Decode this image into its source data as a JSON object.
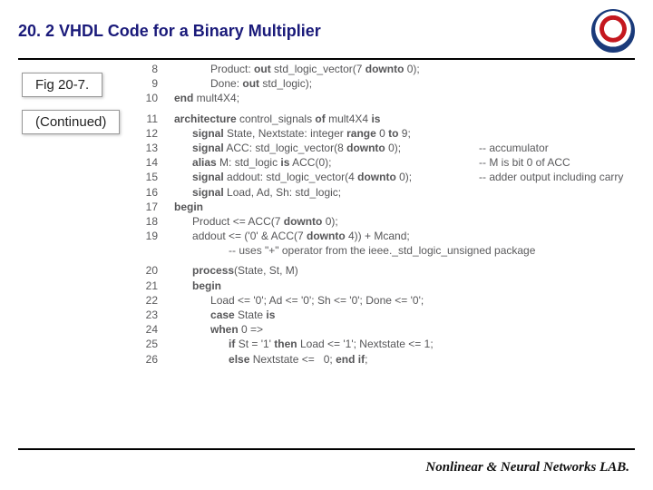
{
  "header": {
    "title": "20. 2 VHDL Code for a Binary Multiplier",
    "logo_name": "university-seal"
  },
  "caption": {
    "fig": "Fig 20-7.",
    "cont": "(Continued)"
  },
  "code": [
    {
      "n": "8",
      "indent": 2,
      "segs": [
        {
          "t": "Product: "
        },
        {
          "t": "out",
          "k": true
        },
        {
          "t": " std_logic_vector(7 "
        },
        {
          "t": "downto",
          "k": true
        },
        {
          "t": " 0);"
        }
      ]
    },
    {
      "n": "9",
      "indent": 2,
      "segs": [
        {
          "t": "Done: "
        },
        {
          "t": "out",
          "k": true
        },
        {
          "t": " std_logic);"
        }
      ]
    },
    {
      "n": "10",
      "indent": 0,
      "segs": [
        {
          "t": "end",
          "k": true
        },
        {
          "t": " mult4X4;"
        }
      ]
    },
    {
      "gap": true
    },
    {
      "n": "11",
      "indent": 0,
      "segs": [
        {
          "t": "architecture",
          "k": true
        },
        {
          "t": " control_signals "
        },
        {
          "t": "of",
          "k": true
        },
        {
          "t": " mult4X4 "
        },
        {
          "t": "is",
          "k": true
        }
      ]
    },
    {
      "n": "12",
      "indent": 1,
      "segs": [
        {
          "t": "signal",
          "k": true
        },
        {
          "t": " State, Nextstate: integer "
        },
        {
          "t": "range",
          "k": true
        },
        {
          "t": " 0 "
        },
        {
          "t": "to",
          "k": true
        },
        {
          "t": " 9;"
        }
      ]
    },
    {
      "n": "13",
      "indent": 1,
      "segs": [
        {
          "t": "signal",
          "k": true
        },
        {
          "t": " ACC: std_logic_vector(8 "
        },
        {
          "t": "downto",
          "k": true
        },
        {
          "t": " 0);"
        }
      ],
      "cm": "-- accumulator"
    },
    {
      "n": "14",
      "indent": 1,
      "segs": [
        {
          "t": "alias",
          "k": true
        },
        {
          "t": " M: std_logic "
        },
        {
          "t": "is",
          "k": true
        },
        {
          "t": " ACC(0);"
        }
      ],
      "cm": "-- M is bit 0 of ACC"
    },
    {
      "n": "15",
      "indent": 1,
      "segs": [
        {
          "t": "signal",
          "k": true
        },
        {
          "t": " addout: std_logic_vector(4 "
        },
        {
          "t": "downto",
          "k": true
        },
        {
          "t": " 0);"
        }
      ],
      "cm": "-- adder output including carry"
    },
    {
      "n": "16",
      "indent": 1,
      "segs": [
        {
          "t": "signal",
          "k": true
        },
        {
          "t": " Load, Ad, Sh: std_logic;"
        }
      ]
    },
    {
      "n": "17",
      "indent": 0,
      "segs": [
        {
          "t": "begin",
          "k": true
        }
      ]
    },
    {
      "n": "18",
      "indent": 1,
      "segs": [
        {
          "t": "Product <= ACC(7 "
        },
        {
          "t": "downto",
          "k": true
        },
        {
          "t": " 0);"
        }
      ]
    },
    {
      "n": "19",
      "indent": 1,
      "segs": [
        {
          "t": "addout <= ('0' & ACC(7 "
        },
        {
          "t": "downto",
          "k": true
        },
        {
          "t": " 4)) + Mcand;"
        }
      ]
    },
    {
      "n": "",
      "indent": 3,
      "segs": [
        {
          "t": "-- uses \"+\" operator from the ieee._std_logic_unsigned package",
          "c": true
        }
      ]
    },
    {
      "gap": true
    },
    {
      "n": "20",
      "indent": 1,
      "segs": [
        {
          "t": "process",
          "k": true
        },
        {
          "t": "(State, St, M)"
        }
      ]
    },
    {
      "n": "21",
      "indent": 1,
      "segs": [
        {
          "t": "begin",
          "k": true
        }
      ]
    },
    {
      "n": "22",
      "indent": 2,
      "segs": [
        {
          "t": "Load <= '0'; Ad <= '0'; Sh <= '0'; Done <= '0';"
        }
      ]
    },
    {
      "n": "23",
      "indent": 2,
      "segs": [
        {
          "t": "case",
          "k": true
        },
        {
          "t": " State "
        },
        {
          "t": "is",
          "k": true
        }
      ]
    },
    {
      "n": "24",
      "indent": 2,
      "segs": [
        {
          "t": "when",
          "k": true
        },
        {
          "t": " 0 =>"
        }
      ]
    },
    {
      "n": "25",
      "indent": 3,
      "segs": [
        {
          "t": "if",
          "k": true
        },
        {
          "t": " St = '1' "
        },
        {
          "t": "then",
          "k": true
        },
        {
          "t": " Load <= '1'; Nextstate <= 1;"
        }
      ]
    },
    {
      "n": "26",
      "indent": 3,
      "segs": [
        {
          "t": "else",
          "k": true
        },
        {
          "t": " Nextstate <=   0; "
        },
        {
          "t": "end if",
          "k": true
        },
        {
          "t": ";"
        }
      ]
    }
  ],
  "footer": {
    "lab": "Nonlinear & Neural Networks LAB."
  }
}
